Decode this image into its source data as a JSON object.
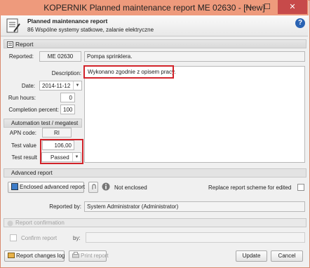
{
  "window": {
    "title": "KOPERNIK Planned maintenance report ME 02630 - [New]",
    "minimize": "—",
    "maximize": "☐",
    "close": "✕"
  },
  "header": {
    "title": "Planned maintenance report",
    "subtitle": "86 Wspólne systemy statkowe, zalanie elektryczne",
    "help": "?"
  },
  "report": {
    "section_title": "Report",
    "reported_label": "Reported:",
    "reported_code": "ME 02630",
    "reported_name": "Pompa sprinklera.",
    "description_label": "Description:",
    "description_value": "Wykonano zgodnie z opisem pracy.",
    "date_label": "Date:",
    "date_value": "2014-11-12",
    "run_hours_label": "Run hours:",
    "run_hours_value": "0",
    "completion_label": "Completion percent:",
    "completion_value": "100"
  },
  "automation": {
    "section_title": "Automation test / megatest",
    "apn_label": "APN code:",
    "apn_value": "RI",
    "test_value_label": "Test value",
    "test_value": "106,00",
    "test_result_label": "Test result",
    "test_result_value": "Passed"
  },
  "advanced": {
    "section_title": "Advanced report",
    "enclosed_button": "Enclosed advanced report",
    "status": "Not enclosed",
    "replace_label": "Replace report scheme for edited",
    "reported_by_label": "Reported by:",
    "reported_by_value": "System Administrator (Administrator)"
  },
  "confirmation": {
    "section_title": "Report confirmation",
    "confirm_label": "Confirm report",
    "by_label": "by:"
  },
  "footer": {
    "changes_log": "Report changes log",
    "print": "Print report",
    "update": "Update",
    "cancel": "Cancel"
  },
  "colors": {
    "titlebar": "#ee9a7c",
    "highlight": "#d2232a",
    "close": "#c74a4a"
  }
}
